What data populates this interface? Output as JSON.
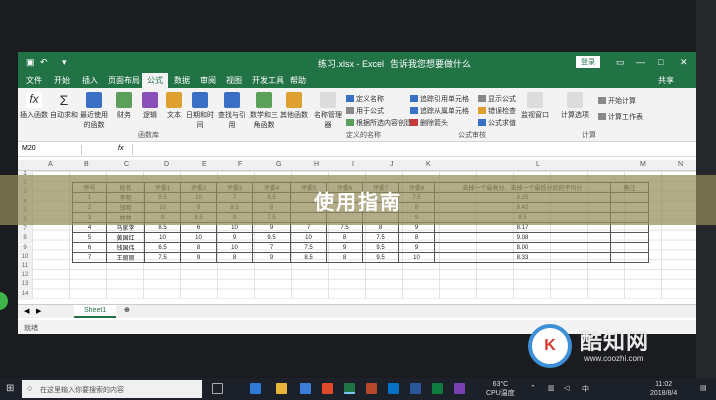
{
  "excel": {
    "title": "练习.xlsx - Excel",
    "tell_me": "告诉我您想要做什么",
    "login": "登录",
    "share": "共享",
    "tabs": [
      "文件",
      "开始",
      "插入",
      "页面布局",
      "公式",
      "数据",
      "审阅",
      "视图",
      "开发工具",
      "帮助"
    ],
    "active_tab": "公式",
    "ribbon": {
      "buttons": [
        "插入函数",
        "自动求和",
        "最近使用的函数",
        "财务",
        "逻辑",
        "文本",
        "日期和时间",
        "查找与引用",
        "数学和三角函数",
        "其他函数",
        "名称管理器"
      ],
      "name_items": [
        "定义名称",
        "用于公式",
        "根据所选内容创建"
      ],
      "audit_items": [
        "追踪引用单元格",
        "追踪从属单元格",
        "删除箭头",
        "显示公式",
        "错误检查",
        "公式求值"
      ],
      "watch": "监视窗口",
      "calc": "计算选项",
      "calc_items": [
        "开始计算",
        "计算工作表"
      ],
      "groups": [
        "函数库",
        "定义的名称",
        "公式审核",
        "计算"
      ]
    },
    "name_box": "M20",
    "fx": "fx",
    "columns": [
      "A",
      "B",
      "C",
      "D",
      "E",
      "F",
      "G",
      "H",
      "I",
      "J",
      "K",
      "L",
      "M",
      "N"
    ],
    "row_numbers": [
      "1",
      "2",
      "3",
      "4",
      "5",
      "6",
      "7",
      "8",
      "9",
      "10",
      "11",
      "12",
      "13",
      "14"
    ],
    "table": {
      "headers": [
        "序号",
        "姓名",
        "评委1",
        "评委2",
        "评委3",
        "评委4",
        "评委5",
        "评委6",
        "评委7",
        "评委8",
        "去掉一个最高分、去掉一个最低分后的平均分",
        "备注"
      ],
      "rows": [
        [
          "1",
          "李明",
          "9.5",
          "10",
          "7",
          "6.5",
          "",
          "",
          "",
          "7.5",
          "8.25",
          ""
        ],
        [
          "2",
          "钱明",
          "10",
          "9",
          "8.5",
          "8",
          "",
          "",
          "",
          "8",
          "8.42",
          ""
        ],
        [
          "3",
          "林林",
          "9",
          "8.5",
          "9",
          "7.5",
          "",
          "",
          "",
          "9",
          "8.5",
          ""
        ],
        [
          "4",
          "马家李",
          "8.5",
          "6",
          "10",
          "9",
          "7",
          "7.5",
          "8",
          "9",
          "8.17",
          ""
        ],
        [
          "5",
          "黄国红",
          "10",
          "10",
          "9",
          "9.5",
          "10",
          "8",
          "7.5",
          "8",
          "9.08",
          ""
        ],
        [
          "6",
          "钱国伟",
          "6.5",
          "8",
          "10",
          "7",
          "7.5",
          "9",
          "9.5",
          "9",
          "8.00",
          ""
        ],
        [
          "7",
          "王丽丽",
          "7.5",
          "9",
          "8",
          "9",
          "8.5",
          "8",
          "9.5",
          "10",
          "8.33",
          ""
        ]
      ]
    },
    "sheet_tab": "Sheet1",
    "ready": "就绪"
  },
  "banner": "使用指南",
  "taskbar": {
    "search_placeholder": "在这里输入你要搜索的内容",
    "weather": "63°C",
    "cpu": "CPU温度",
    "time": "11:02",
    "date": "2018/8/4"
  },
  "watermark": {
    "logo_text": "K",
    "name": "酷知网",
    "url": "www.coozhi.com"
  },
  "colors": {
    "excel_green": "#217346",
    "banner": "#968c5a",
    "taskbar": "#1c2028"
  }
}
